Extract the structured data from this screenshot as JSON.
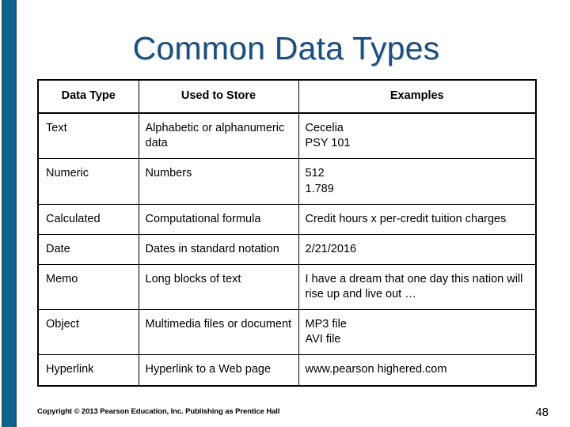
{
  "slide": {
    "title": "Common Data Types",
    "title_color": "#1F4E79",
    "accent_bar_color": "#0A6390",
    "accent_bar_edge_color": "#1A5A4A",
    "background_color": "#FFFFFF"
  },
  "table": {
    "headers": [
      "Data Type",
      "Used to Store",
      "Examples"
    ],
    "rows": [
      {
        "data_type": "Text",
        "used_to_store": "Alphabetic or alphanumeric data",
        "examples_line1": "Cecelia",
        "examples_line2": "PSY 101"
      },
      {
        "data_type": "Numeric",
        "used_to_store": "Numbers",
        "examples_line1": "512",
        "examples_line2": "1.789"
      },
      {
        "data_type": "Calculated",
        "used_to_store": "Computational formula",
        "examples_line1": "Credit hours x per-credit tuition charges",
        "examples_line2": ""
      },
      {
        "data_type": "Date",
        "used_to_store": "Dates in standard notation",
        "examples_line1": "2/21/2016",
        "examples_line2": ""
      },
      {
        "data_type": "Memo",
        "used_to_store": "Long blocks of text",
        "examples_line1": "I have a dream that one day this nation will rise up and live out …",
        "examples_line2": ""
      },
      {
        "data_type": "Object",
        "used_to_store": "Multimedia files or document",
        "examples_line1": "MP3 file",
        "examples_line2": "AVI file"
      },
      {
        "data_type": "Hyperlink",
        "used_to_store": "Hyperlink to a Web page",
        "examples_line1": "www.pearson highered.com",
        "examples_line2": ""
      }
    ]
  },
  "footer": {
    "copyright": "Copyright © 2013 Pearson Education, Inc. Publishing as Prentice Hall",
    "page_number": "48"
  }
}
